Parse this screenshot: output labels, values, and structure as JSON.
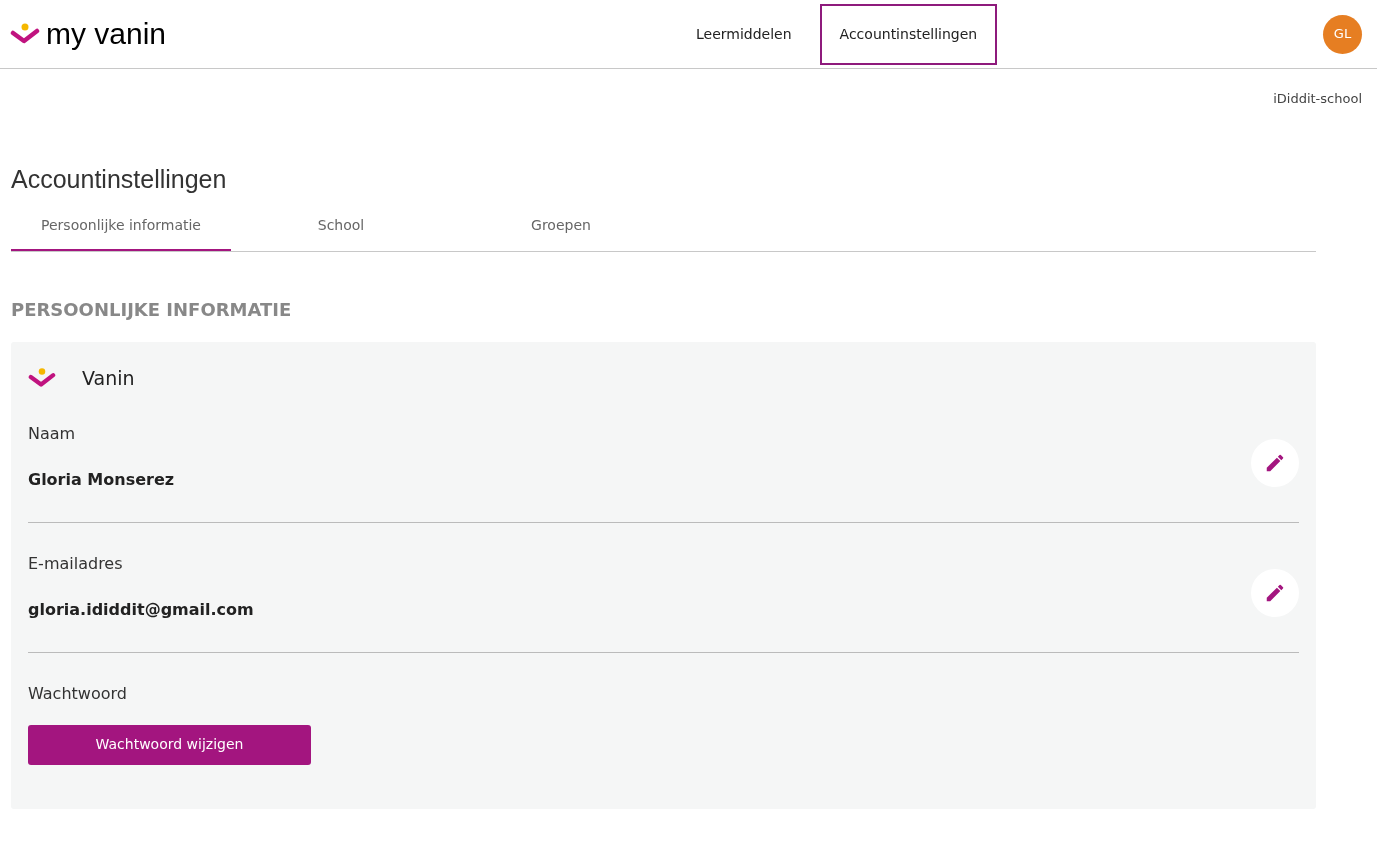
{
  "header": {
    "logo": "my vanin",
    "nav": [
      {
        "label": "Leermiddelen",
        "selected": false
      },
      {
        "label": "Accountinstellingen",
        "selected": true
      }
    ],
    "avatar": "GL"
  },
  "school": "iDiddit-school",
  "page_title": "Accountinstellingen",
  "tabs": [
    {
      "label": "Persoonlijke informatie",
      "selected": true
    },
    {
      "label": "School",
      "selected": false
    },
    {
      "label": "Groepen",
      "selected": false
    }
  ],
  "section_title": "PERSOONLIJKE INFORMATIE",
  "card": {
    "title": "Vanin",
    "fields": [
      {
        "kind": "editable",
        "label": "Naam",
        "value": "Gloria Monserez"
      },
      {
        "kind": "editable",
        "label": "E-mailadres",
        "value": "gloria.ididdit@gmail.com"
      },
      {
        "kind": "action",
        "label": "Wachtwoord",
        "button": "Wachtwoord wijzigen"
      }
    ]
  }
}
